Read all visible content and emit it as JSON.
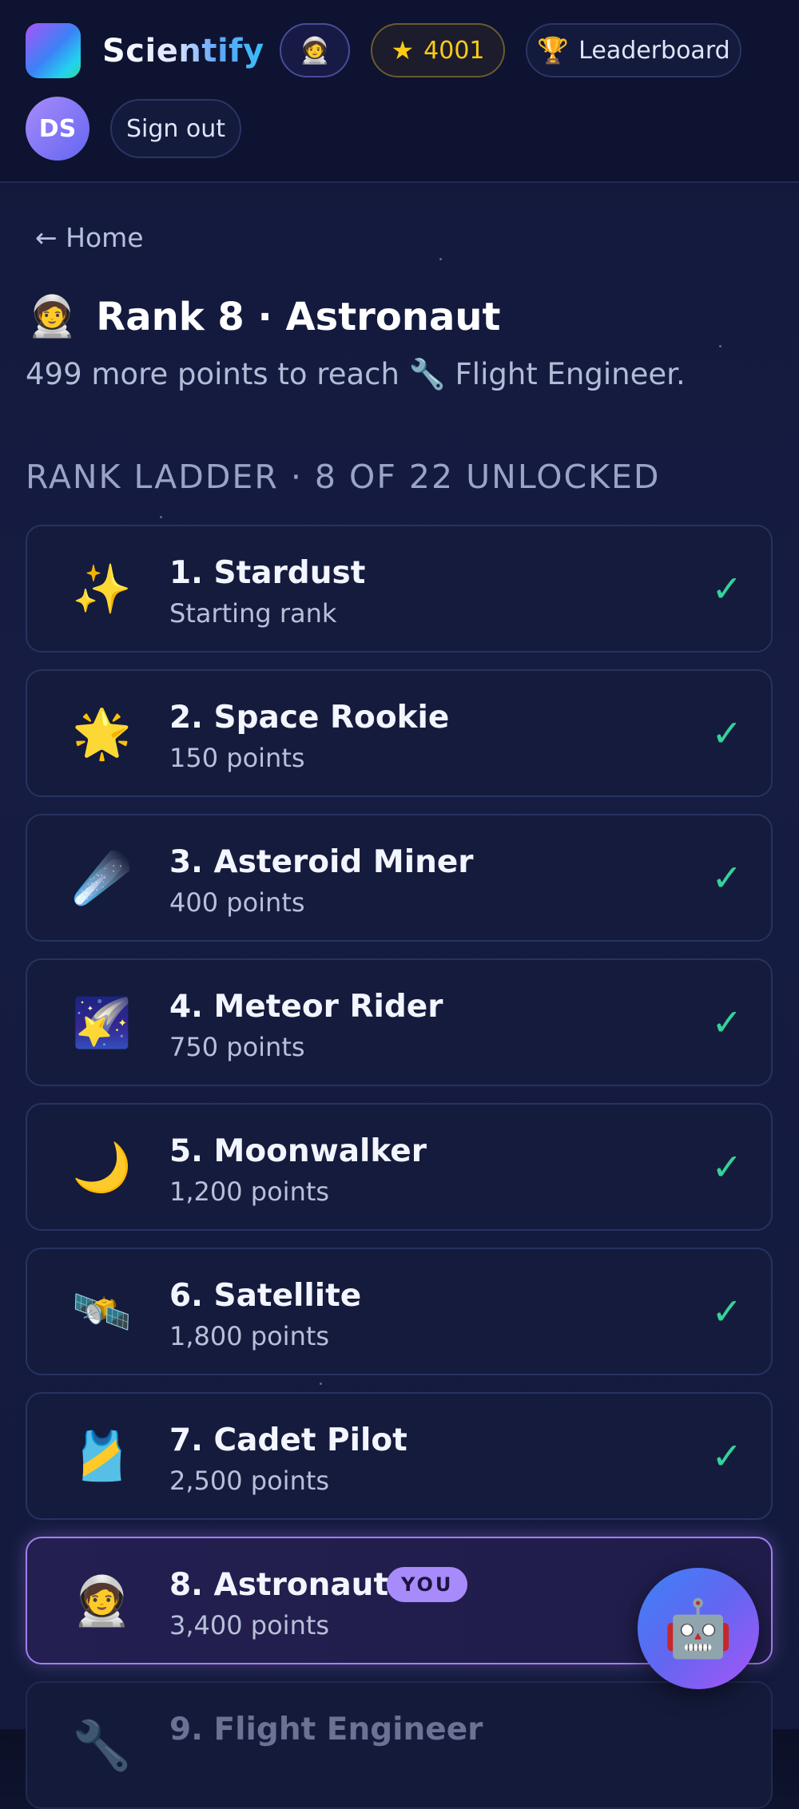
{
  "header": {
    "brand": "Scientify",
    "avatar_emoji": "🧑‍🚀",
    "points_icon": "★",
    "points": "4001",
    "leaderboard_icon": "🏆",
    "leaderboard_label": "Leaderboard",
    "user_initials": "DS",
    "signout_label": "Sign out"
  },
  "main": {
    "back_label": "← Home",
    "title_emoji": "🧑‍🚀",
    "title": "Rank 8 · Astronaut",
    "subtitle": "499 more points to reach 🔧 Flight Engineer.",
    "section_heading": "RANK LADDER · 8 OF 22 UNLOCKED",
    "you_badge": "YOU",
    "check_glyph": "✓",
    "ranks": [
      {
        "emoji": "✨",
        "name": "1. Stardust",
        "req": "Starting rank"
      },
      {
        "emoji": "🌟",
        "name": "2. Space Rookie",
        "req": "150 points"
      },
      {
        "emoji": "☄️",
        "name": "3. Asteroid Miner",
        "req": "400 points"
      },
      {
        "emoji": "🌠",
        "name": "4. Meteor Rider",
        "req": "750 points"
      },
      {
        "emoji": "🌙",
        "name": "5. Moonwalker",
        "req": "1,200 points"
      },
      {
        "emoji": "🛰️",
        "name": "6. Satellite",
        "req": "1,800 points"
      },
      {
        "emoji": "🎽",
        "name": "7. Cadet Pilot",
        "req": "2,500 points"
      },
      {
        "emoji": "🧑‍🚀",
        "name": "8. Astronaut",
        "req": "3,400 points"
      },
      {
        "emoji": "🔧",
        "name": "9. Flight Engineer",
        "req": ""
      }
    ]
  },
  "assistant": {
    "icon": "🤖"
  },
  "colors": {
    "accent": "#a78bfa",
    "check": "#34d399",
    "points": "#facc15",
    "background": "#141a3d"
  }
}
